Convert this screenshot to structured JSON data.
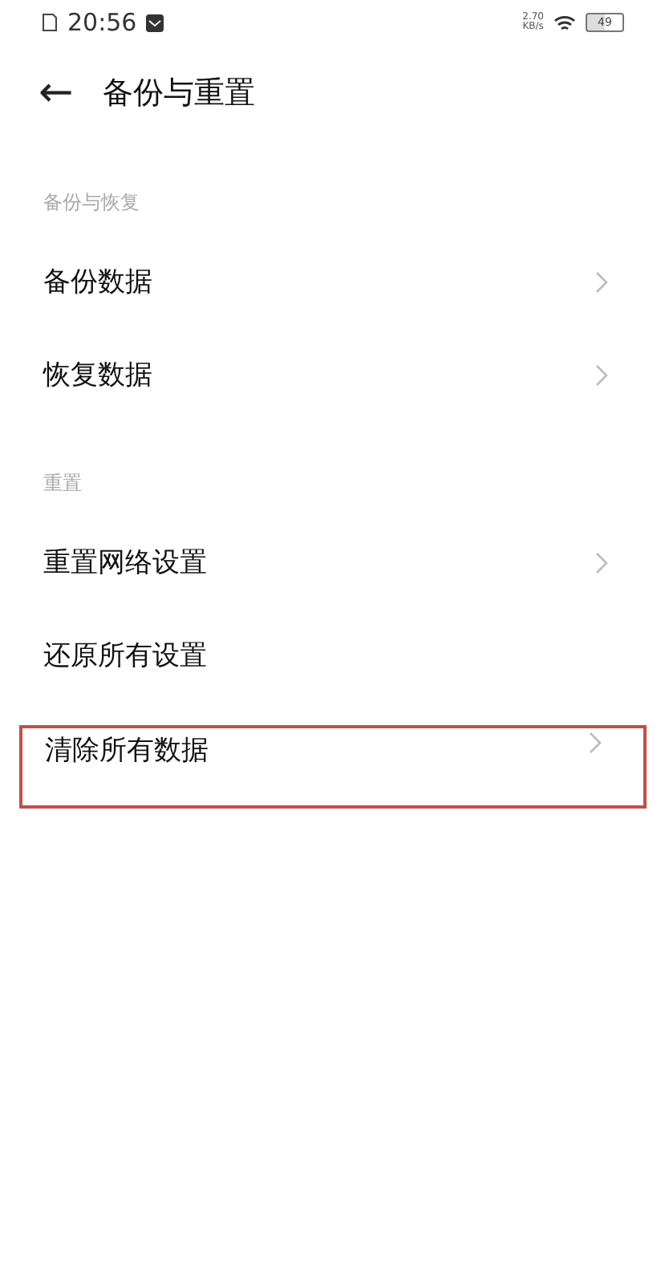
{
  "status_bar": {
    "time": "20:56",
    "speed_value": "2.70",
    "speed_unit": "KB/s",
    "battery": "49"
  },
  "header": {
    "back_icon": "←",
    "title": "备份与重置"
  },
  "sections": [
    {
      "title": "备份与恢复",
      "items": [
        {
          "label": "备份数据",
          "chevron": true,
          "highlighted": false
        },
        {
          "label": "恢复数据",
          "chevron": true,
          "highlighted": false
        }
      ]
    },
    {
      "title": "重置",
      "items": [
        {
          "label": "重置网络设置",
          "chevron": true,
          "highlighted": false
        },
        {
          "label": "还原所有设置",
          "chevron": false,
          "highlighted": false
        },
        {
          "label": "清除所有数据",
          "chevron": true,
          "highlighted": true
        }
      ]
    }
  ]
}
